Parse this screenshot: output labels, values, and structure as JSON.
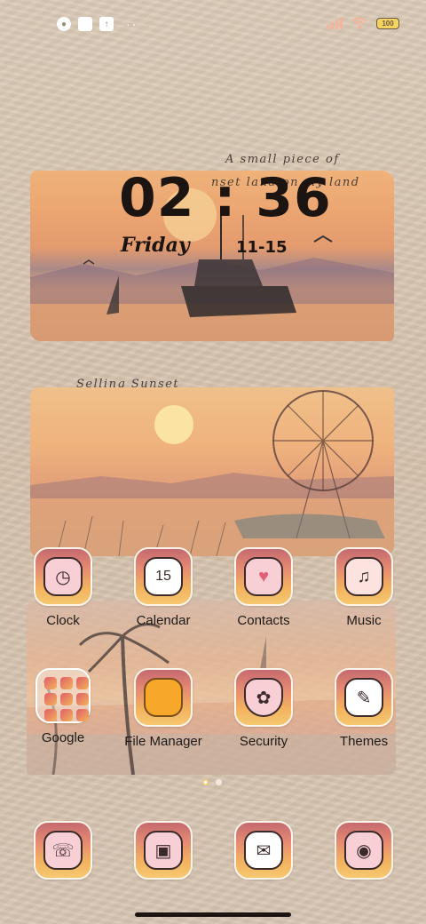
{
  "status_bar": {
    "left_icons": [
      "notification-icon",
      "square-app-icon",
      "upload-icon"
    ],
    "overflow": "··",
    "battery": "100"
  },
  "clock_widget": {
    "quote_line1": "A small piece of",
    "quote_line2": "nset land on my land",
    "time": "02 : 36",
    "day": "Friday",
    "date": "11-15"
  },
  "picture_widget": {
    "caption": "Selling Sunset"
  },
  "apps": [
    {
      "label": "Clock",
      "icon": "clock-icon",
      "glyph": "◷"
    },
    {
      "label": "Calendar",
      "icon": "calendar-icon",
      "glyph": "15"
    },
    {
      "label": "Contacts",
      "icon": "contacts-icon",
      "glyph": "♥"
    },
    {
      "label": "Music",
      "icon": "music-icon",
      "glyph": "♫"
    },
    {
      "label": "Google",
      "icon": "google-folder-icon",
      "glyph": ""
    },
    {
      "label": "File Manager",
      "icon": "folder-icon",
      "glyph": "▬"
    },
    {
      "label": "Security",
      "icon": "shield-icon",
      "glyph": "✿"
    },
    {
      "label": "Themes",
      "icon": "brush-icon",
      "glyph": "✎"
    }
  ],
  "dock": [
    {
      "icon": "phone-icon",
      "glyph": "☏"
    },
    {
      "icon": "gallery-icon",
      "glyph": "▣"
    },
    {
      "icon": "message-icon",
      "glyph": "✉"
    },
    {
      "icon": "camera-icon",
      "glyph": "◉"
    }
  ],
  "colors": {
    "accent": "#f2b25f",
    "text": "#1d1a18"
  }
}
